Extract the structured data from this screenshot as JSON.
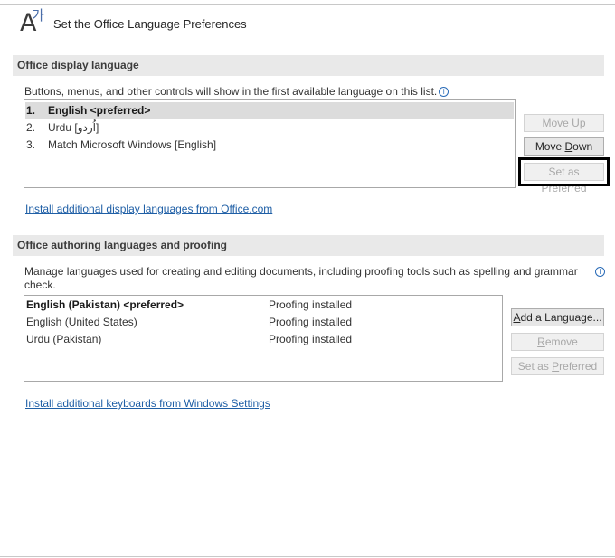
{
  "header": {
    "title": "Set the Office Language Preferences",
    "icon_latin": "A",
    "icon_hangul": "가"
  },
  "display_section": {
    "heading": "Office display language",
    "description": "Buttons, menus, and other controls will show in the first available language on this list.",
    "languages": [
      {
        "num": "1.",
        "label": "English <preferred>"
      },
      {
        "num": "2.",
        "label": "Urdu [اُردو]"
      },
      {
        "num": "3.",
        "label": "Match Microsoft Windows [English]"
      }
    ],
    "buttons": {
      "move_up": {
        "pre": "Move ",
        "acc": "U",
        "post": "p"
      },
      "move_down": {
        "pre": "Move ",
        "acc": "D",
        "post": "own"
      },
      "set_preferred": "Set as Preferred"
    },
    "link": "Install additional display languages from Office.com"
  },
  "authoring_section": {
    "heading": "Office authoring languages and proofing",
    "description_line1": "Manage languages used for creating and editing documents, including proofing tools such as spelling and grammar",
    "description_line2": "check.",
    "languages": [
      {
        "name": "English (Pakistan) <preferred>",
        "status": "Proofing installed"
      },
      {
        "name": "English (United States)",
        "status": "Proofing installed"
      },
      {
        "name": "Urdu (Pakistan)",
        "status": "Proofing installed"
      }
    ],
    "buttons": {
      "add": {
        "pre": "",
        "acc": "A",
        "post": "dd a Language..."
      },
      "remove": {
        "pre": "",
        "acc": "R",
        "post": "emove"
      },
      "set_preferred": {
        "pre": "Set as ",
        "acc": "P",
        "post": "referred"
      }
    },
    "link": "Install additional keyboards from Windows Settings"
  }
}
